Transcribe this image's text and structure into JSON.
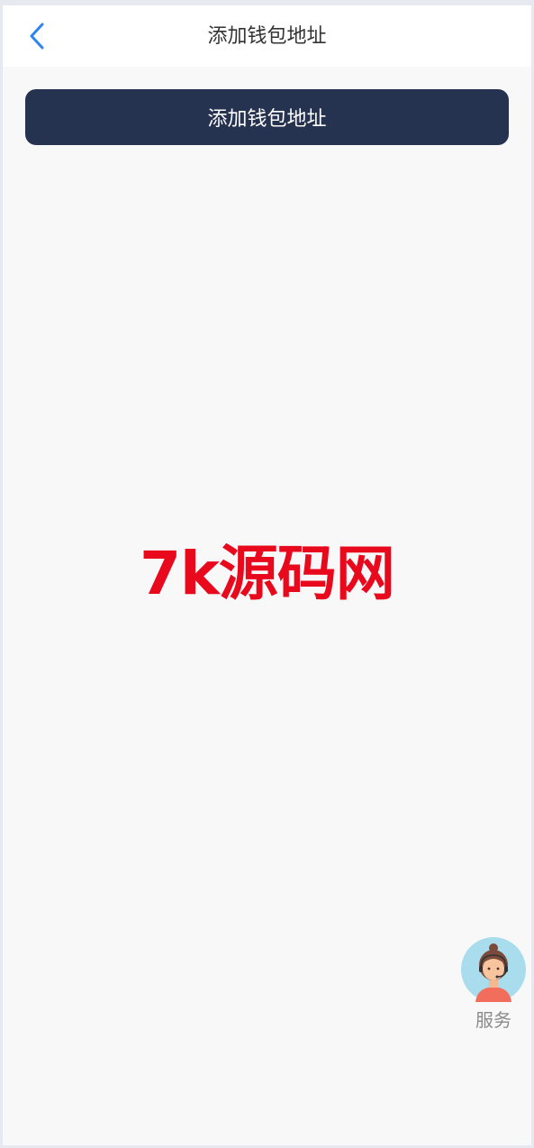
{
  "header": {
    "title": "添加钱包地址",
    "back_icon": "chevron-left-icon",
    "back_color": "#2d84f0"
  },
  "main": {
    "add_button_label": "添加钱包地址",
    "add_button_color": "#253250"
  },
  "watermark": {
    "text": "7k源码网",
    "color": "#e8091d"
  },
  "service": {
    "label": "服务",
    "icon": "customer-service-avatar-icon"
  }
}
